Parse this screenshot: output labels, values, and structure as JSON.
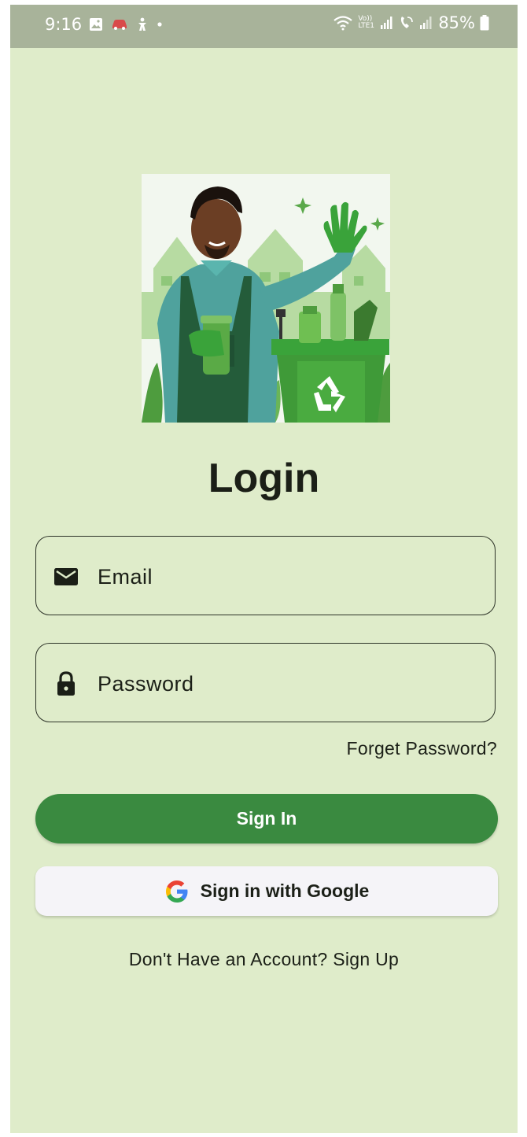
{
  "status_bar": {
    "time": "9:16",
    "network_label": "Vo)) LTE1",
    "battery": "85%"
  },
  "page": {
    "title": "Login"
  },
  "form": {
    "email_placeholder": "Email",
    "password_placeholder": "Password",
    "forgot_label": "Forget Password?"
  },
  "actions": {
    "sign_in_label": "Sign In",
    "google_label": "Sign in with Google",
    "signup_prompt": "Don't Have an Account? Sign Up"
  },
  "colors": {
    "background": "#dfecca",
    "primary": "#3a8a40",
    "status_bar": "#a8b39a"
  }
}
